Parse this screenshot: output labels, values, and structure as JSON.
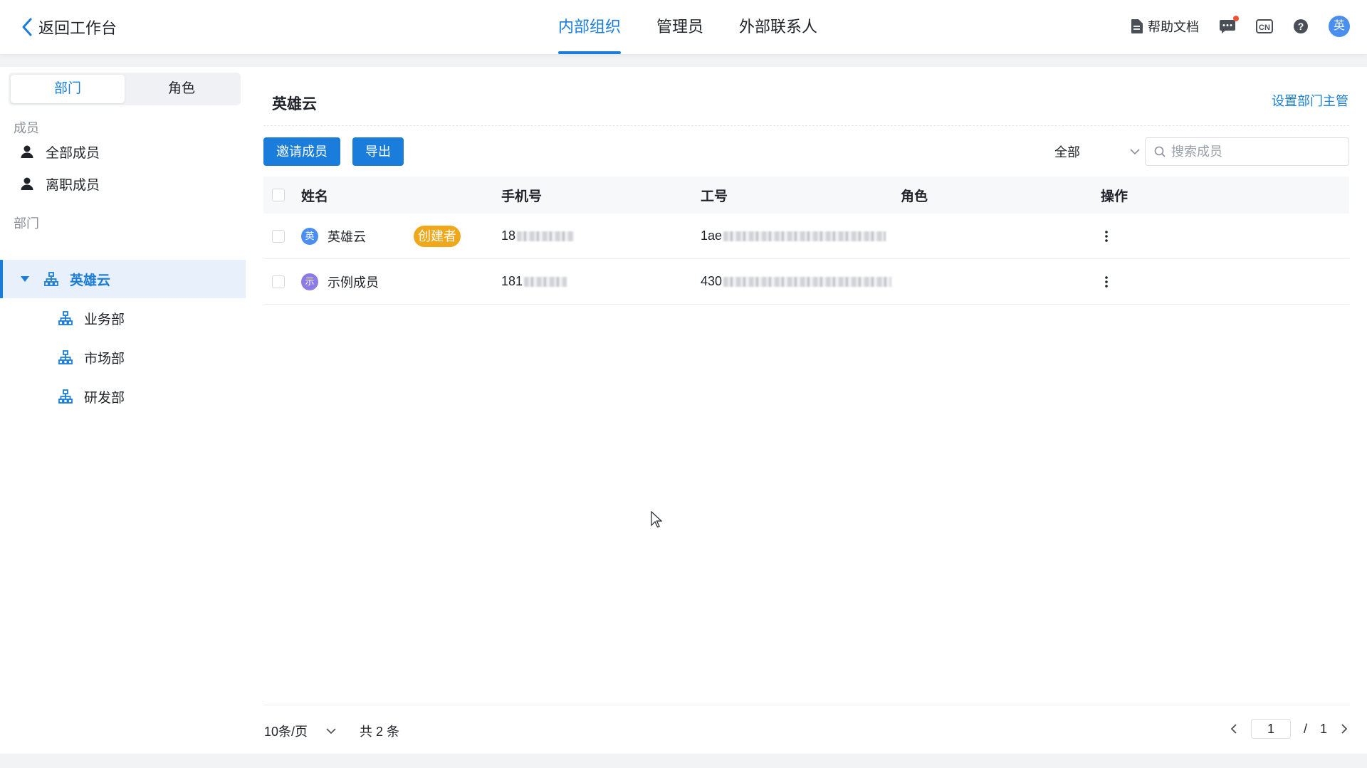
{
  "header": {
    "back_label": "返回工作台",
    "tabs": [
      "内部组织",
      "管理员",
      "外部联系人"
    ],
    "active_tab": "内部组织",
    "help_docs": "帮助文档",
    "lang_badge": "CN",
    "avatar_text": "英"
  },
  "sidebar": {
    "segments": [
      "部门",
      "角色"
    ],
    "members_label": "成员",
    "member_items": [
      "全部成员",
      "离职成员"
    ],
    "dept_label": "部门",
    "root_dept": "英雄云",
    "sub_depts": [
      "业务部",
      "市场部",
      "研发部"
    ]
  },
  "main": {
    "dept_title": "英雄云",
    "set_manager": "设置部门主管",
    "invite_button": "邀请成员",
    "export_button": "导出",
    "filter_value": "全部",
    "search_placeholder": "搜索成员",
    "columns": [
      "姓名",
      "手机号",
      "工号",
      "角色",
      "操作"
    ],
    "rows": [
      {
        "avatar": "英",
        "avatar_color": "#4a8ef0",
        "name": "英雄云",
        "badge": "创建者",
        "phone": "18",
        "job_no": "1ae"
      },
      {
        "avatar": "示",
        "avatar_color": "#8c7ae6",
        "name": "示例成员",
        "badge": "",
        "phone": "181",
        "job_no": "430"
      }
    ],
    "pagination": {
      "page_size": "10条/页",
      "total": "共 2 条",
      "current_page": "1",
      "separator": "/",
      "total_pages": "1"
    }
  },
  "colors": {
    "accent": "#1a7ddb",
    "creator_badge": "#f0a81a"
  }
}
